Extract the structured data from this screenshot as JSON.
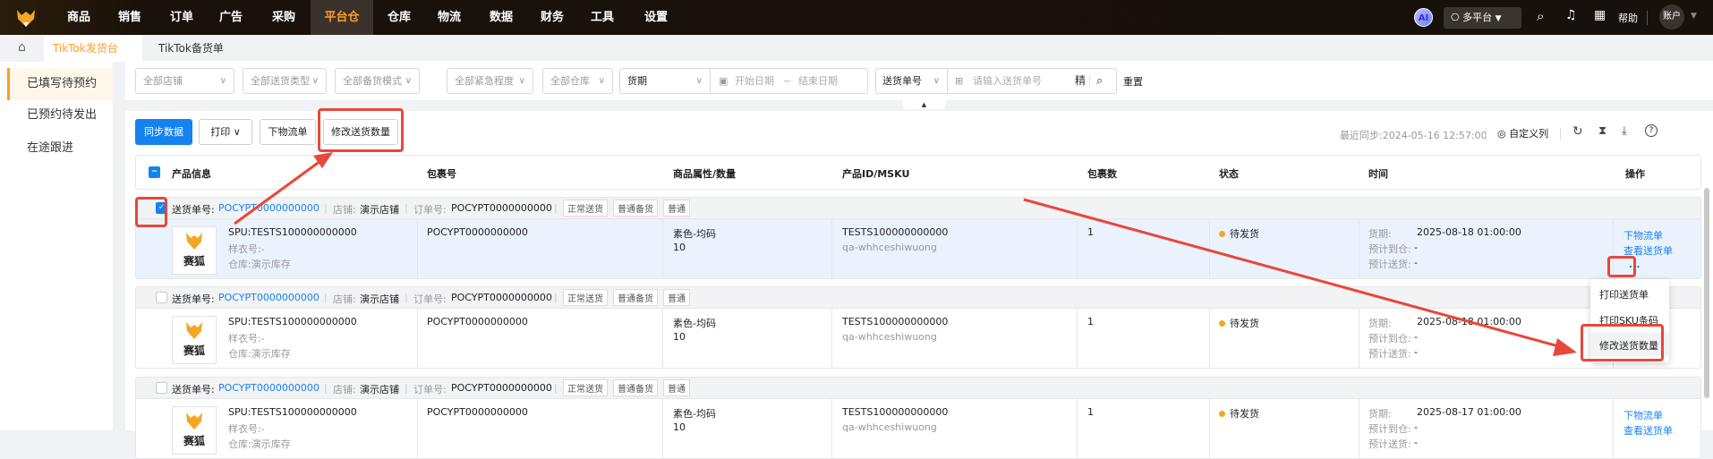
{
  "nav": {
    "items": [
      "商品",
      "销售",
      "订单",
      "广告",
      "采购",
      "平台仓",
      "仓库",
      "物流",
      "数据",
      "财务",
      "工具",
      "设置"
    ],
    "active": "平台仓",
    "ai_label": "AI",
    "platform_label": "多平台",
    "help_label": "帮助",
    "account_label": "账户"
  },
  "tabs": [
    {
      "label": "TikTok发货台",
      "active": true
    },
    {
      "label": "TikTok备货单",
      "active": false
    }
  ],
  "sidebar": {
    "items": [
      "已填写待预约",
      "已预约待发出",
      "在途跟进"
    ]
  },
  "filters": {
    "store": "全部店铺",
    "ship_type": "全部送货类型",
    "stock_mode": "全部备货模式",
    "urgency": "全部紧急程度",
    "warehouse": "全部仓库",
    "date_type": "货期",
    "start_placeholder": "开始日期",
    "range_sep": "~",
    "end_placeholder": "结束日期",
    "search_type": "送货单号",
    "search_placeholder": "请输入送货单号",
    "exact_label": "精",
    "reset_label": "重置"
  },
  "toolbar": {
    "sync": "同步数据",
    "print": "打印",
    "logistics": "下物流单",
    "modify_qty": "修改送货数量",
    "last_sync": "最近同步:2024-05-16 12:57:00",
    "custom_columns": "自定义列"
  },
  "table": {
    "headers": [
      "产品信息",
      "包裹号",
      "商品属性/数量",
      "产品ID/MSKU",
      "包裹数",
      "状态",
      "时间",
      "操作"
    ],
    "groups": [
      {
        "checked": true,
        "selected": true,
        "ship_label": "送货单号:",
        "ship_no": "POCYPT0000000000",
        "store_label": "店铺:",
        "store": "演示店铺",
        "order_label": "订单号:",
        "order_no": "POCYPT0000000000",
        "tags": [
          "正常送货",
          "普通备货",
          "普通"
        ],
        "brand": "赛狐",
        "spu": "SPU:TESTS100000000000",
        "sample": "样衣号:-",
        "warehouse": "仓库:演示库存",
        "package_no": "POCYPT0000000000",
        "attr": "素色-均码",
        "qty": "10",
        "product_id": "TESTS100000000000",
        "msku": "qa-whhceshiwuong",
        "packages": "1",
        "status": "待发货",
        "due_label": "货期:",
        "due": "2025-08-18 01:00:00",
        "arrive_label": "预计到仓:",
        "arrive": "-",
        "ship_time_label": "预计送货:",
        "ship_time": "-",
        "actions": [
          "下物流单",
          "查看送货单",
          "..."
        ]
      },
      {
        "checked": false,
        "selected": false,
        "ship_label": "送货单号:",
        "ship_no": "POCYPT0000000000",
        "store_label": "店铺:",
        "store": "演示店铺",
        "order_label": "订单号:",
        "order_no": "POCYPT0000000000",
        "tags": [
          "正常送货",
          "普通备货",
          "普通"
        ],
        "brand": "赛狐",
        "spu": "SPU:TESTS100000000000",
        "sample": "样衣号:-",
        "warehouse": "仓库:演示库存",
        "package_no": "POCYPT0000000000",
        "attr": "素色-均码",
        "qty": "10",
        "product_id": "TESTS100000000000",
        "msku": "qa-whhceshiwuong",
        "packages": "1",
        "status": "待发货",
        "due_label": "货期:",
        "due": "2025-08-18 01:00:00",
        "arrive_label": "预计到仓:",
        "arrive": "-",
        "ship_time_label": "预计送货:",
        "ship_time": "-",
        "actions": []
      },
      {
        "checked": false,
        "selected": false,
        "ship_label": "送货单号:",
        "ship_no": "POCYPT0000000000",
        "store_label": "店铺:",
        "store": "演示店铺",
        "order_label": "订单号:",
        "order_no": "POCYPT0000000000",
        "tags": [
          "正常送货",
          "普通备货",
          "普通"
        ],
        "brand": "赛狐",
        "spu": "SPU:TESTS100000000000",
        "sample": "样衣号:-",
        "warehouse": "仓库:演示库存",
        "package_no": "POCYPT0000000000",
        "attr": "素色-均码",
        "qty": "10",
        "product_id": "TESTS100000000000",
        "msku": "qa-whhceshiwuong",
        "packages": "1",
        "status": "待发货",
        "due_label": "货期:",
        "due": "2025-08-17 01:00:00",
        "arrive_label": "预计到仓:",
        "arrive": "-",
        "ship_time_label": "预计送货:",
        "ship_time": "-",
        "actions": [
          "下物流单",
          "查看送货单"
        ]
      }
    ]
  },
  "more_menu": {
    "items": [
      "打印送货单",
      "打印SKU条码",
      "修改送货数量"
    ]
  },
  "colors": {
    "accent": "#ff9d1f",
    "primary": "#1482f0",
    "annotation": "#e8473a"
  }
}
